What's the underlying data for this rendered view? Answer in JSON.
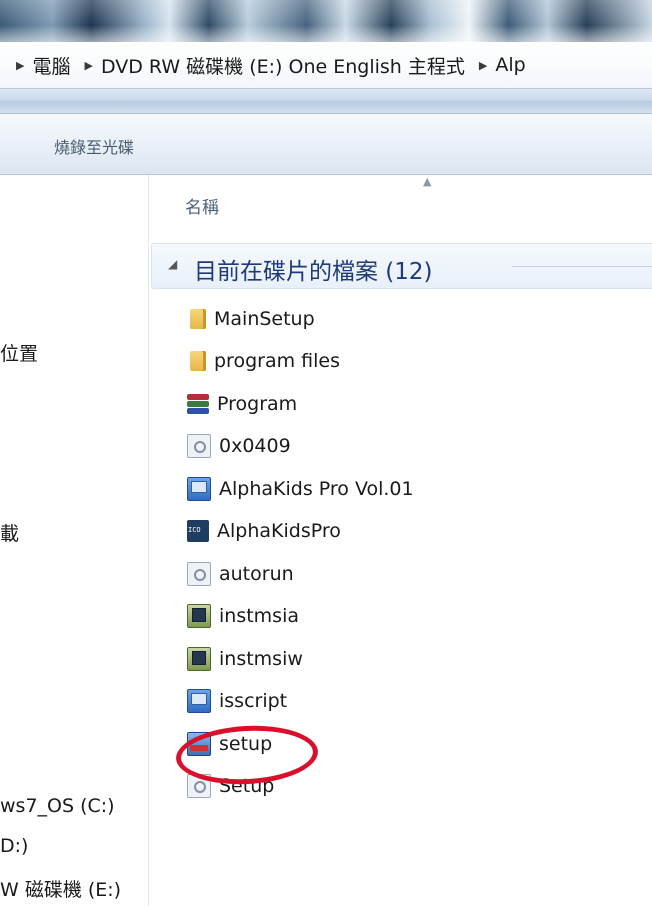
{
  "breadcrumb": {
    "items": [
      {
        "label": "電腦"
      },
      {
        "label": "DVD RW 磁碟機 (E:) One English 主程式"
      },
      {
        "label": "Alp"
      }
    ]
  },
  "toolbar": {
    "burn_label": "燒錄至光碟"
  },
  "nav_pane": {
    "items": [
      {
        "label": "位置"
      },
      {
        "label": "載"
      },
      {
        "label": "ws7_OS (C:)"
      },
      {
        "label": "D:)"
      },
      {
        "label": "W 磁碟機 (E:)"
      }
    ]
  },
  "columns": {
    "name_label": "名稱"
  },
  "group": {
    "title": "目前在碟片的檔案 (12)"
  },
  "files": [
    {
      "name": "MainSetup",
      "icon": "folder-icon"
    },
    {
      "name": "program files",
      "icon": "folder-icon"
    },
    {
      "name": "Program",
      "icon": "winrar-archive-icon"
    },
    {
      "name": "0x0409",
      "icon": "settings-file-icon"
    },
    {
      "name": "AlphaKids Pro Vol.01",
      "icon": "setup-package-icon"
    },
    {
      "name": "AlphaKidsPro",
      "icon": "ico-file-icon"
    },
    {
      "name": "autorun",
      "icon": "settings-file-icon"
    },
    {
      "name": "instmsia",
      "icon": "installer-icon"
    },
    {
      "name": "instmsiw",
      "icon": "installer-icon"
    },
    {
      "name": "isscript",
      "icon": "setup-package-icon"
    },
    {
      "name": "setup",
      "icon": "setup-exe-icon"
    },
    {
      "name": "Setup",
      "icon": "settings-file-icon"
    }
  ],
  "highlight": {
    "color": "#d8102a",
    "target": "setup"
  }
}
